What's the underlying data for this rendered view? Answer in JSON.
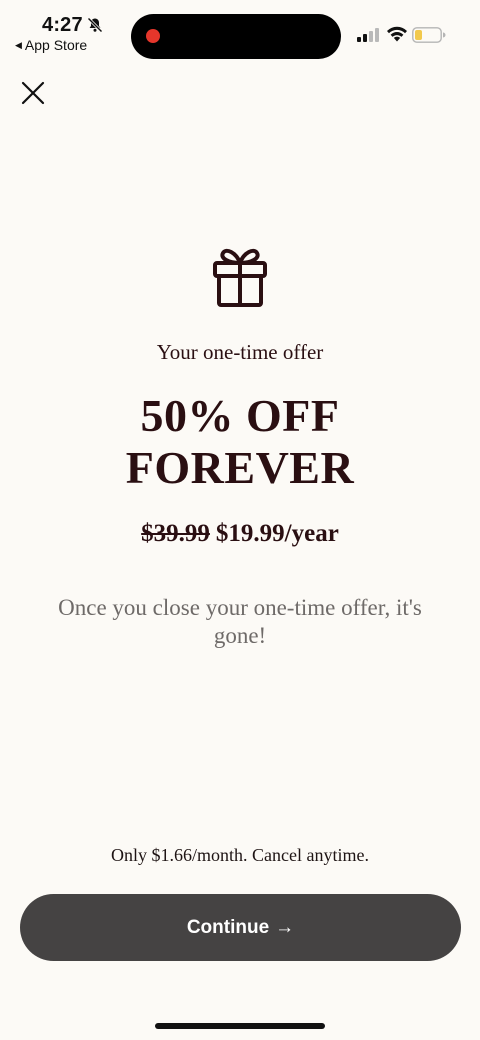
{
  "status_bar": {
    "time": "4:27",
    "back_app": "App Store",
    "back_arrow": "◀",
    "icons": {
      "silent": "bell-slash-icon",
      "signal": "cellular-signal-icon",
      "wifi": "wifi-icon",
      "battery": "battery-low-icon"
    },
    "recording_color": "#e5362b",
    "battery_color": "#f2c94c"
  },
  "close": {
    "icon": "close-icon"
  },
  "offer": {
    "icon": "gift-icon",
    "subtitle": "Your one-time offer",
    "headline_line1": "50% OFF",
    "headline_line2": "FOREVER",
    "old_price": "$39.99",
    "new_price": "$19.99/year",
    "warning": "Once you close your one-time offer, it's gone!"
  },
  "footer": {
    "fineprint": "Only $1.66/month. Cancel anytime.",
    "continue_label": "Continue",
    "continue_arrow": "→"
  },
  "colors": {
    "background": "#fcfaf6",
    "text": "#2a0f12",
    "button": "#454343",
    "muted_text": "#6e6a68"
  }
}
